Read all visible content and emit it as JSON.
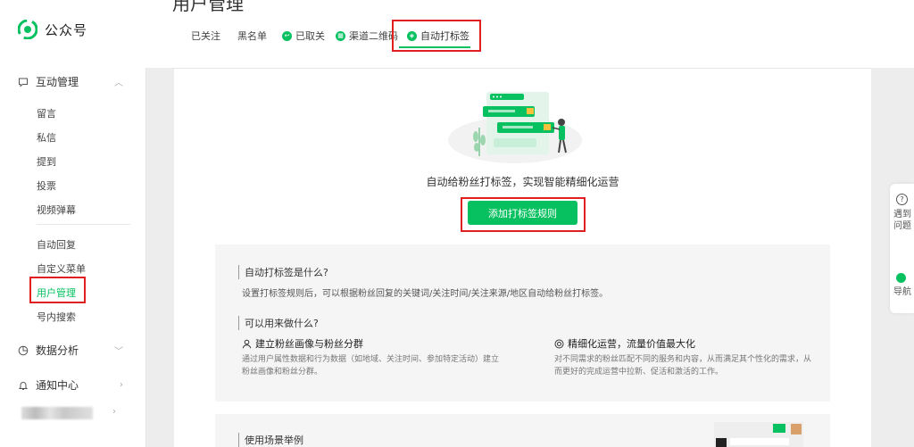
{
  "brand": "公众号",
  "page_title": "用户管理",
  "sidebar": {
    "sections": [
      {
        "label": "互动管理",
        "arrow": "︿"
      },
      {
        "label": "数据分析",
        "arrow": "﹀"
      },
      {
        "label": "通知中心",
        "arrow": "›"
      }
    ],
    "items": [
      "留言",
      "私信",
      "提到",
      "投票",
      "视频弹幕",
      "自动回复",
      "自定义菜单",
      "用户管理",
      "号内搜索"
    ],
    "account_arrow": "›"
  },
  "tabs": [
    "已关注",
    "黑名单",
    "已取关",
    "渠道二维码",
    "自动打标签"
  ],
  "slogan": "自动给粉丝打标签，实现智能精细化运营",
  "cta_label": "添加打标签规则",
  "info": {
    "q1": "自动打标签是什么?",
    "a1": "设置打标签规则后，可以根据粉丝回复的关键词/关注时间/关注来源/地区自动给粉丝打标签。",
    "q2": "可以用来做什么?",
    "f1_title": "建立粉丝画像与粉丝分群",
    "f1_desc_1": "通过用户属性数据和行为数据（如地域、关注时间、参加特定活动）建立",
    "f1_desc_2": "粉丝画像和粉丝分群。",
    "f2_title": "精细化运营，流量价值最大化",
    "f2_desc_1": "对不同需求的粉丝匹配不同的服务和内容，从而满足其个性化的需求，从",
    "f2_desc_2": "而更好的完成运营中拉新、促活和激活的工作。",
    "q3": "使用场景举例"
  },
  "float": {
    "help_label": "遇到问题",
    "nav_label": "导航"
  },
  "colors": {
    "accent": "#07c160",
    "highlight": "#e02020"
  }
}
